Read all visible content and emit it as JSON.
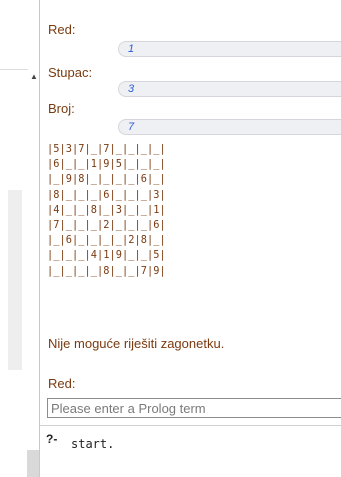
{
  "scrollbar": {
    "up_arrow": "▲"
  },
  "form": {
    "row_label": "Red:",
    "row_value": "1",
    "col_label": "Stupac:",
    "col_value": "3",
    "num_label": "Broj:",
    "num_value": "7"
  },
  "board": {
    "rows": [
      "|5|3|7|_|7|_|_|_|_|",
      "|6|_|_|1|9|5|_|_|_|",
      "|_|9|8|_|_|_|_|6|_|",
      "|8|_|_|_|6|_|_|_|3|",
      "|4|_|_|8|_|3|_|_|1|",
      "|7|_|_|_|2|_|_|_|6|",
      "|_|6|_|_|_|_|2|8|_|",
      "|_|_|_|4|1|9|_|_|5|",
      "|_|_|_|_|8|_|_|7|9|"
    ]
  },
  "message": "Nije moguće riješiti zagonetku.",
  "next_prompt_label": "Red:",
  "input": {
    "placeholder": "Please enter a Prolog term",
    "value": ""
  },
  "query": {
    "marker": "?-",
    "text": "start."
  }
}
